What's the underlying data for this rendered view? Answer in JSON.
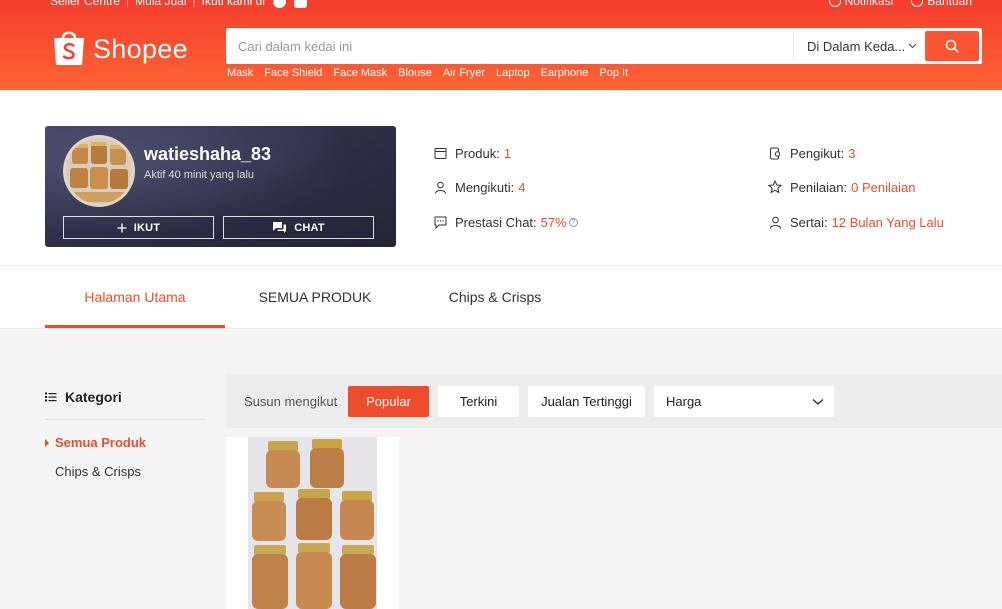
{
  "topbar": {
    "seller_centre": "Seller Centre",
    "start_selling": "Mula Jual",
    "follow_us": "Ikuti kami di",
    "notifications": "Notifikasi",
    "help": "Bantuan"
  },
  "brand": {
    "name": "Shopee",
    "color": "#ee4d2d"
  },
  "search": {
    "placeholder": "Cari dalam kedai ini",
    "scope": "Di Dalam Keda...",
    "suggestions": [
      "Mask",
      "Face Shield",
      "Face Mask",
      "Blouse",
      "Air Fryer",
      "Laptop",
      "Earphone",
      "Pop It"
    ]
  },
  "shop": {
    "name": "watieshaha_83",
    "active": "Aktif 40 minit yang lalu",
    "follow_label": "IKUT",
    "chat_label": "CHAT",
    "stats": {
      "products_label": "Produk:",
      "products_value": "1",
      "following_label": "Mengikuti:",
      "following_value": "4",
      "chat_perf_label": "Prestasi Chat:",
      "chat_perf_value": "57%",
      "followers_label": "Pengikut:",
      "followers_value": "3",
      "rating_label": "Penilaian:",
      "rating_value": "0 Penilaian",
      "joined_label": "Sertai:",
      "joined_value": "12 Bulan Yang Lalu"
    }
  },
  "tabs": [
    "Halaman Utama",
    "SEMUA PRODUK",
    "Chips & Crisps"
  ],
  "sidebar": {
    "title": "Kategori",
    "items": [
      "Semua Produk",
      "Chips & Crisps"
    ]
  },
  "sort": {
    "label": "Susun mengikut",
    "options": [
      "Popular",
      "Terkini",
      "Jualan Tertinggi"
    ],
    "price": "Harga"
  }
}
